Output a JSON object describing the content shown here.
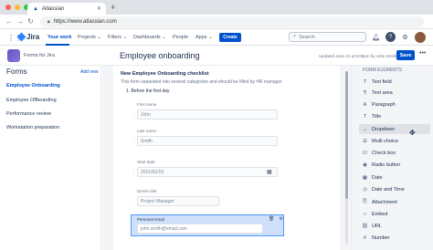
{
  "browser": {
    "tab_title": "Atlassian",
    "url": "https://www.atlassian.com"
  },
  "topnav": {
    "product": "Jira",
    "items": [
      "Your work",
      "Projects",
      "Filters",
      "Dashboards",
      "People",
      "Apps"
    ],
    "create_label": "Create",
    "search_placeholder": "Search"
  },
  "sidebar": {
    "project_name": "Forms for Jira",
    "title": "Forms",
    "add_label": "Add new",
    "items": [
      "Employee Onboarding",
      "Employee Offboarding",
      "Performance review",
      "Workstation preparation"
    ],
    "active_index": 0
  },
  "header": {
    "title": "Employee onboarding",
    "updated": "Updated June 21 at 5:05pm by John Smith",
    "save_label": "Save",
    "more_label": "•••"
  },
  "form": {
    "title": "New Employee Onboarding checklist",
    "description": "This form separated into several categories and should be filled by HR manager",
    "section": "1. Before the first day",
    "fields": [
      {
        "label": "First name",
        "value": "John"
      },
      {
        "label": "Last name",
        "value": "Smith"
      },
      {
        "label": "Start date",
        "value": "2021/02/19"
      },
      {
        "label": "Desire title",
        "value": "Project Manager"
      },
      {
        "label": "Personal email",
        "value": "john.smith@email.com"
      }
    ]
  },
  "elements": {
    "title": "FORM ELEMENTS",
    "items": [
      {
        "label": "Text field",
        "icon": "T"
      },
      {
        "label": "Text area",
        "icon": "¶"
      },
      {
        "label": "Paragraph",
        "icon": "A"
      },
      {
        "label": "Title",
        "icon": "T"
      },
      {
        "label": "Dropdown",
        "icon": "⌄"
      },
      {
        "label": "Multi choice",
        "icon": "☰"
      },
      {
        "label": "Check box",
        "icon": "☑"
      },
      {
        "label": "Radio button",
        "icon": "◉"
      },
      {
        "label": "Date",
        "icon": "▦"
      },
      {
        "label": "Date and Time",
        "icon": "◷"
      },
      {
        "label": "Attachment",
        "icon": "⎘"
      },
      {
        "label": "Embed",
        "icon": "‹›"
      },
      {
        "label": "URL",
        "icon": "⛓"
      },
      {
        "label": "Number",
        "icon": "#"
      }
    ]
  },
  "colors": {
    "brand": "#0052cc",
    "selected_bg": "#cfe0fd"
  }
}
